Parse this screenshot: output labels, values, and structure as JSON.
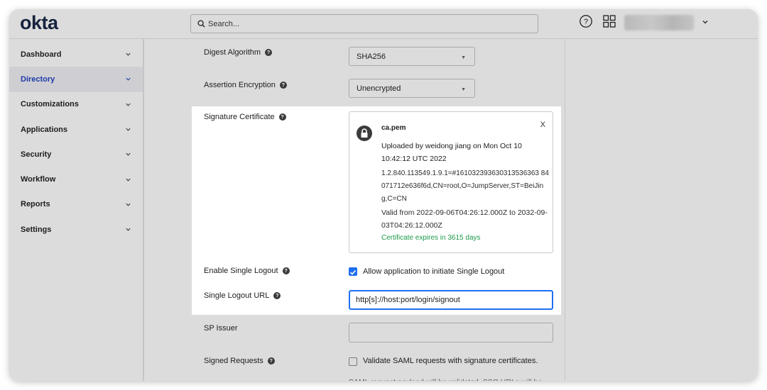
{
  "header": {
    "logo": "okta",
    "search_placeholder": "Search..."
  },
  "sidebar": {
    "items": [
      {
        "label": "Dashboard",
        "active": false
      },
      {
        "label": "Directory",
        "active": true
      },
      {
        "label": "Customizations",
        "active": false
      },
      {
        "label": "Applications",
        "active": false
      },
      {
        "label": "Security",
        "active": false
      },
      {
        "label": "Workflow",
        "active": false
      },
      {
        "label": "Reports",
        "active": false
      },
      {
        "label": "Settings",
        "active": false
      }
    ]
  },
  "form": {
    "digest_algorithm": {
      "label": "Digest Algorithm",
      "value": "SHA256"
    },
    "assertion_encryption": {
      "label": "Assertion Encryption",
      "value": "Unencrypted"
    },
    "signature_certificate": {
      "label": "Signature Certificate",
      "file_name": "ca.pem",
      "close": "X",
      "uploaded": "Uploaded by weidong jiang on Mon Oct 10 10:42:12 UTC 2022",
      "dn": "1.2.840.113549.1.9.1=#161032393630313536363 84071712e636f6d,CN=root,O=JumpServer,ST=BeiJing,C=CN",
      "valid": "Valid from 2022-09-06T04:26:12.000Z to 2032-09-03T04:26:12.000Z",
      "expires": "Certificate expires in 3615 days"
    },
    "enable_single_logout": {
      "label": "Enable Single Logout",
      "checkbox_label": "Allow application to initiate Single Logout",
      "checked": true
    },
    "single_logout_url": {
      "label": "Single Logout URL",
      "value": "http[s]://host:port/login/signout"
    },
    "sp_issuer": {
      "label": "SP Issuer",
      "value": ""
    },
    "signed_requests": {
      "label": "Signed Requests",
      "checkbox_label": "Validate SAML requests with signature certificates.",
      "checked": false,
      "note": "SAML request payload will be validated. SSO URLs will be"
    }
  },
  "colors": {
    "accent": "#1e6ff1",
    "active_nav": "#1e3aa8",
    "success": "#1d9a4a"
  }
}
